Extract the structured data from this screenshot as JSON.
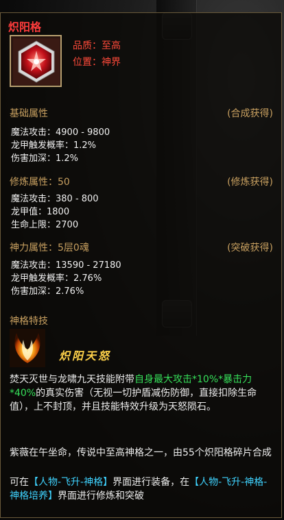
{
  "colors": {
    "title": "#ff3c3c",
    "section": "#c8a060",
    "highlight_green": "#36e05a",
    "link_cyan": "#3fd3ff",
    "frame": "#b8a070"
  },
  "tooltip": {
    "title": "炽阳格",
    "icon": "red-hexagon-gem-icon",
    "quality_label": "品质：至高",
    "position_label": "位置：神界"
  },
  "sections": [
    {
      "title": "基础属性",
      "source": "(合成获得)",
      "stats": [
        "魔法攻击：4900 - 9800",
        "龙甲触发概率：1.2%",
        "伤害加深：1.2%"
      ]
    },
    {
      "title": "修炼属性：50",
      "source": "(修炼获得)",
      "stats": [
        "魔法攻击：380 - 800",
        "龙甲值：1800",
        "生命上限：2700"
      ]
    },
    {
      "title": "神力属性：5层0魂",
      "source": "(突破获得)",
      "stats": [
        "魔法攻击：13590 - 27180",
        "龙甲触发概率：2.76%",
        "伤害加深：2.76%"
      ]
    }
  ],
  "skill": {
    "section_title": "神格特技",
    "icon": "blazing-wings-icon",
    "name": "炽阳天怒",
    "desc_part1": "焚天灭世与龙啸九天技能附带",
    "desc_green": "自身最大攻击*10%*暴击力*40%",
    "desc_part2": "的真实伤害（无视一切护盾减伤防御，直接扣除生命值），上不封顶，并且技能特效升级为天怒陨石。"
  },
  "lore": {
    "text": "紫薇在午坐命，传说中至高神格之一，由55个炽阳格碎片合成",
    "equip_prefix": "可在",
    "equip_link1": "【人物-飞升-神格】",
    "equip_mid": "界面进行装备，在",
    "equip_link2": "【人物-飞升-神格-神格培养】",
    "equip_suffix": "界面进行修炼和突破"
  }
}
